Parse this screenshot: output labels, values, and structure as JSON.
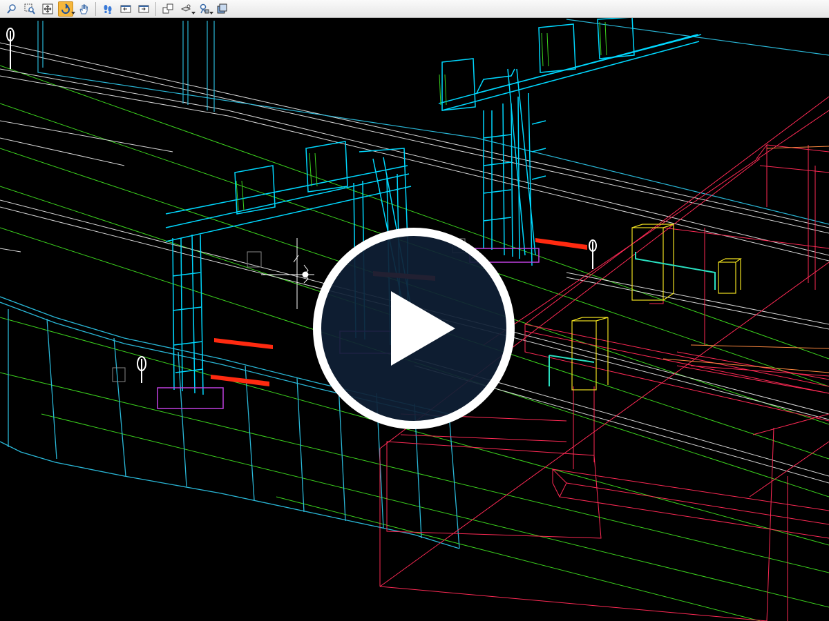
{
  "toolbar": {
    "tools": [
      {
        "icon": "zoom-icon",
        "active": false,
        "dropdown": false
      },
      {
        "icon": "zoom-window-icon",
        "active": false,
        "dropdown": false
      },
      {
        "icon": "fit-view-icon",
        "active": false,
        "dropdown": false
      },
      {
        "icon": "rotate-view-icon",
        "active": true,
        "dropdown": true
      },
      {
        "icon": "pan-hand-icon",
        "active": false,
        "dropdown": false
      },
      {
        "icon": "walk-footprints-icon",
        "active": false,
        "dropdown": false
      },
      {
        "icon": "previous-view-icon",
        "active": false,
        "dropdown": false
      },
      {
        "icon": "next-view-icon",
        "active": false,
        "dropdown": false
      },
      {
        "icon": "view-layout-icon",
        "active": false,
        "dropdown": false
      },
      {
        "icon": "camera-icon",
        "active": false,
        "dropdown": true
      },
      {
        "icon": "clip-volume-icon",
        "active": false,
        "dropdown": true
      },
      {
        "icon": "display-style-icon",
        "active": false,
        "dropdown": false
      }
    ]
  },
  "viewport": {
    "background": "#000000",
    "colors": {
      "gantry": "#00d8ff",
      "barrier": "#2ab8d8",
      "rail": "#d8d8d8",
      "lane_lines": "#3cd21e",
      "bridge": "#ff2a55",
      "footing": "#c040e0",
      "marker": "#ff2a10",
      "signal": "#f0e020"
    }
  },
  "play_button": {
    "icon": "play-icon",
    "fill": "#0f2035",
    "ring": "#ffffff"
  }
}
